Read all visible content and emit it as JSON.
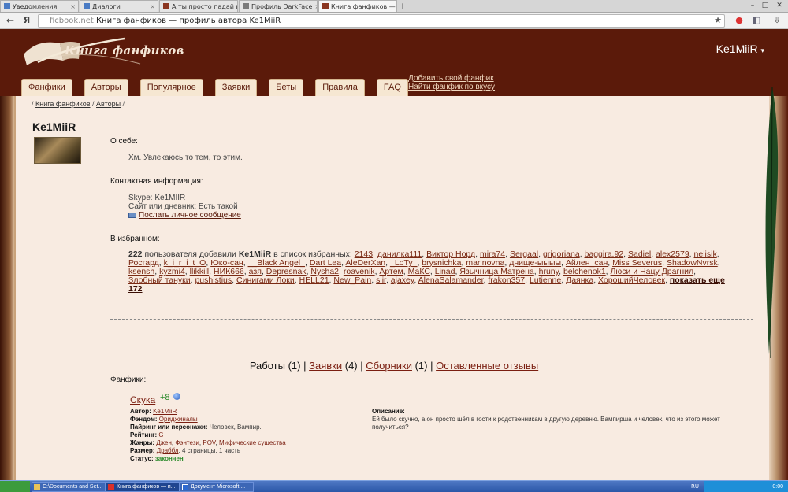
{
  "browser": {
    "tabs": [
      {
        "label": "Уведомления",
        "icon": "blue"
      },
      {
        "label": "Диалоги",
        "icon": "blue"
      },
      {
        "label": "А ты просто падай вниз...",
        "icon": "ficbook"
      },
      {
        "label": "Профиль DarkFace",
        "icon": "gray"
      },
      {
        "label": "Книга фанфиков — про...",
        "icon": "ficbook",
        "active": true
      }
    ],
    "url_host": "ficbook.net",
    "url_title": "Книга фанфиков — профиль автора Ke1MiiR"
  },
  "site": {
    "logo_text": "Книга фанфиков",
    "user_menu": "Ke1MiiR",
    "user_menu_caret": "▾",
    "nav": [
      "Фанфики",
      "Авторы",
      "Популярное",
      "Заявки",
      "Беты",
      "Правила",
      "FAQ"
    ],
    "nav_extra": [
      "Добавить свой фанфик",
      "Найти фанфик по вкусу"
    ]
  },
  "breadcrumb": {
    "sep": "/",
    "items": [
      "Книга фанфиков",
      "Авторы"
    ]
  },
  "profile": {
    "username": "Ke1MiiR",
    "about_title": "О себе:",
    "about_text": "Хм. Увлекаюсь то тем, то этим.",
    "contact_title": "Контактная информация:",
    "skype": "Skype: Ke1MIIR",
    "site": "Сайт или дневник: Есть такой",
    "message_link": "Послать личное сообщение",
    "favorites_title": "В избранном:",
    "fav_count": "222",
    "fav_text_1": "пользователя добавили",
    "fav_user": "Ke1MiiR",
    "fav_text_2": "в список избранных:",
    "fav_users": [
      "2143",
      "данилка111",
      "Виктор Норд",
      "mira74",
      "Sergaal",
      "grigoriana",
      "baggira.92",
      "Sadiel",
      "alex2579",
      "nelisik",
      "Росгард",
      "k_i_r_i_t_O",
      "Юко-сан",
      "__Black Angel_",
      "Dart Lea",
      "AleDerXan",
      "_LoTy_",
      "brysnichka",
      "marinovna",
      "днище-ыыыы",
      "Айлен_сан",
      "Miss Severus",
      "ShadowNvrsk",
      "ksensh",
      "kyzmi4",
      "llikkill",
      "НИК666",
      "aзя",
      "Depresnak",
      "Nysha2",
      "roavenik",
      "Артем",
      "МаКС",
      "Linad",
      "Язычница Матрена",
      "hruny",
      "belchenok1",
      "Люси и Нацу Драгнил",
      "Злобный тануки",
      "pushistius",
      "Синигами Локи",
      "HELL21",
      "New_Pain",
      "siir",
      "ajaxey",
      "AlenaSalamander",
      "frakon357",
      "Lutienne",
      "Даянка",
      "ХорошийЧеловек"
    ],
    "show_more": "показать еще 172"
  },
  "works": {
    "works_label": "Работы (1)",
    "requests_link": "Заявки",
    "requests_count": "(4)",
    "collections_link": "Сборники",
    "collections_count": "(1)",
    "reviews_link": "Оставленные отзывы",
    "sep": "|"
  },
  "fanfics": {
    "title": "Фанфики:",
    "items": [
      {
        "name": "Скука",
        "likes": "+8",
        "author_label": "Автор:",
        "author": "Ke1MiiR",
        "fandom_label": "Фэндом:",
        "fandom": "Ориджиналы",
        "pairing_label": "Пайринг или персонажи:",
        "pairing": "Человек, Вампир.",
        "rating_label": "Рейтинг:",
        "rating": "G",
        "genres_label": "Жанры:",
        "genres": [
          "Джен",
          "Фэнтези",
          "POV",
          "Мифические существа"
        ],
        "size_label": "Размер:",
        "size_link": "Драббл",
        "size_rest": ", 4 страницы, 1 часть",
        "status_label": "Статус:",
        "status": "закончен",
        "desc_label": "Описание:",
        "desc": "Ей было скучно, а он просто шёл в гости к родственникам в другую деревню. Вампирша и человек, что из этого может получиться?"
      }
    ]
  },
  "taskbar": {
    "tasks": [
      {
        "label": "C:\\Documents and Set...",
        "icon": "folder"
      },
      {
        "label": "Книга фанфиков — п...",
        "icon": "yandex",
        "active": true
      },
      {
        "label": "Документ Microsoft ...",
        "icon": "word"
      }
    ],
    "lang": "RU",
    "clock": "0:00"
  }
}
